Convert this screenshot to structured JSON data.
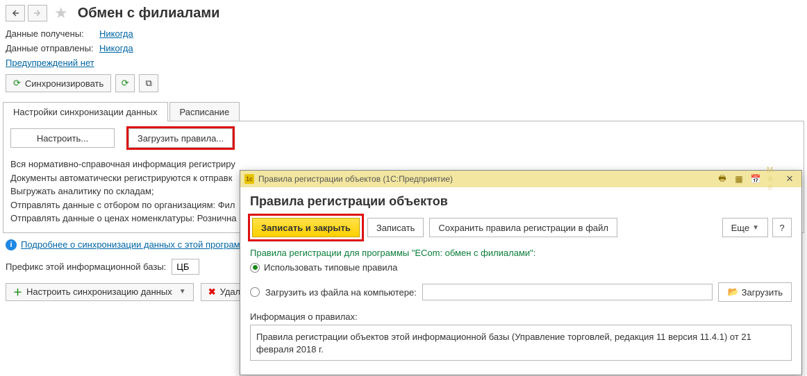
{
  "header": {
    "title": "Обмен с филиалами"
  },
  "info": {
    "received_label": "Данные получены:",
    "received_value": "Никогда",
    "sent_label": "Данные отправлены:",
    "sent_value": "Никогда",
    "warnings_link": "Предупреждений нет"
  },
  "toolbar": {
    "sync_label": "Синхронизировать"
  },
  "tabs": {
    "tab1": "Настройки синхронизации данных",
    "tab2": "Расписание"
  },
  "tab_content": {
    "configure_btn": "Настроить...",
    "load_rules_btn": "Загрузить правила...",
    "info_lines": {
      "l1": "Вся нормативно-справочная информация регистриру",
      "l2": "Документы автоматически регистрируются к отправк",
      "l3": "Выгружать аналитику по складам;",
      "l4": "Отправлять данные с отбором по организациям: Фил",
      "l5": "Отправлять данные о ценах номенклатуры: Рознична"
    }
  },
  "more_link": "Подробнее о синхронизации данных с этой програм",
  "prefix": {
    "label": "Префикс этой информационной базы:",
    "value": "ЦБ"
  },
  "bottom": {
    "configure_sync": "Настроить синхронизацию данных",
    "delete": "Удали"
  },
  "dialog": {
    "titlebar": "Правила регистрации объектов  (1С:Предприятие)",
    "heading": "Правила регистрации объектов",
    "save_close": "Записать и закрыть",
    "save": "Записать",
    "save_rules_file": "Сохранить правила регистрации в файл",
    "more": "Еще",
    "subhead": "Правила регистрации для программы \"ECom: обмен с филиалами\":",
    "radio1": "Использовать типовые правила",
    "radio2": "Загрузить из файла на компьютере:",
    "load_btn": "Загрузить",
    "info_label": "Информация о правилах:",
    "info_text": "Правила регистрации объектов этой информационной базы (Управление торговлей, редакция 11 версия 11.4.1) от 21 февраля 2018 г."
  }
}
